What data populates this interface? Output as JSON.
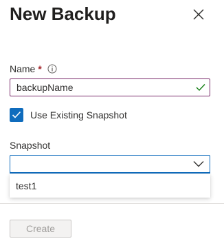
{
  "panel": {
    "title": "New Backup",
    "close_icon": "close-icon"
  },
  "name_field": {
    "label": "Name",
    "required_marker": "*",
    "info_icon": "info-icon",
    "value": "backupName",
    "valid_icon": "checkmark-icon"
  },
  "use_existing_snapshot": {
    "label": "Use Existing Snapshot",
    "checked": true
  },
  "snapshot_field": {
    "label": "Snapshot",
    "value": "",
    "chevron_icon": "chevron-down-icon",
    "options": [
      "test1"
    ]
  },
  "footer": {
    "create_label": "Create",
    "create_disabled": true
  },
  "colors": {
    "accent": "#0f6cbd",
    "input_border": "#7a2b6b",
    "required": "#a4262c",
    "valid": "#107c10"
  }
}
